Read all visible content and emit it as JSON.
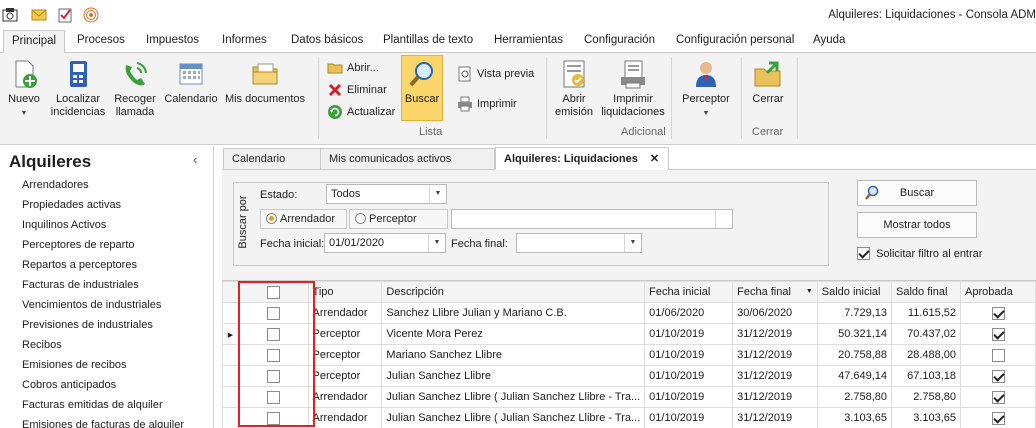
{
  "window": {
    "title": "Alquileres: Liquidaciones - Consola ADM"
  },
  "ribbon_tabs": [
    "Principal",
    "Procesos",
    "Impuestos",
    "Informes",
    "Datos básicos",
    "Plantillas de texto",
    "Herramientas",
    "Configuración",
    "Configuración personal",
    "Ayuda"
  ],
  "ribbon": {
    "nuevo": "Nuevo",
    "localizar": "Localizar incidencias",
    "recoger": "Recoger llamada",
    "calendario": "Calendario",
    "mis_documentos": "Mis documentos",
    "abrir": "Abrir...",
    "eliminar": "Eliminar",
    "actualizar": "Actualizar",
    "buscar": "Buscar",
    "vista_previa": "Vista previa",
    "imprimir": "Imprimir",
    "group_lista": "Lista",
    "abrir_emision": "Abrir emisión",
    "imprimir_liquidaciones": "Imprimir liquidaciones",
    "group_adicional": "Adicional",
    "perceptor": "Perceptor",
    "cerrar": "Cerrar",
    "group_cerrar": "Cerrar"
  },
  "sidebar": {
    "title": "Alquileres",
    "items": [
      "Arrendadores",
      "Propiedades activas",
      "Inquilinos Activos",
      "Perceptores de reparto",
      "Repartos a perceptores",
      "Facturas de industriales",
      "Vencimientos de industriales",
      "Previsiones de industriales",
      "Recibos",
      "Emisiones de recibos",
      "Cobros anticipados",
      "Facturas emitidas de alquiler",
      "Emisiones de facturas de alquiler"
    ]
  },
  "doc_tabs": [
    "Calendario",
    "Mis comunicados activos",
    "Alquileres: Liquidaciones"
  ],
  "filter": {
    "group_label": "Buscar por",
    "estado_label": "Estado:",
    "estado_value": "Todos",
    "radio_arrendador": "Arrendador",
    "radio_perceptor": "Perceptor",
    "search_text": "",
    "fecha_inicial_label": "Fecha inicial:",
    "fecha_inicial_value": "01/01/2020",
    "fecha_final_label": "Fecha final:",
    "fecha_final_value": "",
    "buscar_btn": "Buscar",
    "mostrar_todos_btn": "Mostrar todos",
    "solicitar_filtro": "Solicitar filtro al entrar",
    "solicitar_filtro_checked": true
  },
  "grid": {
    "columns": [
      "Tipo",
      "Descripción",
      "Fecha inicial",
      "Fecha final",
      "Saldo inicial",
      "Saldo final",
      "Aprobada"
    ],
    "rows": [
      {
        "tipo": "Arrendador",
        "descripcion": "Sanchez Llibre Julian y Mariano C.B.",
        "fecha_inicial": "01/06/2020",
        "fecha_final": "30/06/2020",
        "saldo_inicial": "7.729,13",
        "saldo_final": "11.615,52",
        "aprobada": true
      },
      {
        "tipo": "Perceptor",
        "descripcion": "Vicente Mora Perez",
        "fecha_inicial": "01/10/2019",
        "fecha_final": "31/12/2019",
        "saldo_inicial": "50.321,14",
        "saldo_final": "70.437,02",
        "aprobada": true
      },
      {
        "tipo": "Perceptor",
        "descripcion": "Mariano Sanchez Llibre",
        "fecha_inicial": "01/10/2019",
        "fecha_final": "31/12/2019",
        "saldo_inicial": "20.758,88",
        "saldo_final": "28.488,00",
        "aprobada": false
      },
      {
        "tipo": "Perceptor",
        "descripcion": "Julian Sanchez Llibre",
        "fecha_inicial": "01/10/2019",
        "fecha_final": "31/12/2019",
        "saldo_inicial": "47.649,14",
        "saldo_final": "67.103,18",
        "aprobada": true
      },
      {
        "tipo": "Arrendador",
        "descripcion": "Julian Sanchez Llibre ( Julian Sanchez Llibre - Tra...",
        "fecha_inicial": "01/10/2019",
        "fecha_final": "31/12/2019",
        "saldo_inicial": "2.758,80",
        "saldo_final": "2.758,80",
        "aprobada": true
      },
      {
        "tipo": "Arrendador",
        "descripcion": "Julian Sanchez Llibre ( Julian Sanchez Llibre - Tra...",
        "fecha_inicial": "01/10/2019",
        "fecha_final": "31/12/2019",
        "saldo_inicial": "3.103,65",
        "saldo_final": "3.103,65",
        "aprobada": true
      }
    ]
  },
  "colors": {
    "accent": "#2b63b8",
    "highlight": "#fbd66a",
    "annotation": "#e2231a"
  }
}
